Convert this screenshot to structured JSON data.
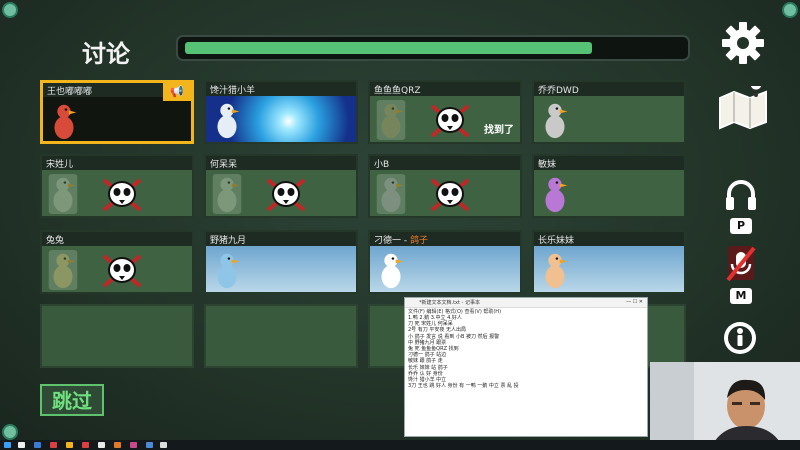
{
  "header": {
    "title": "讨论",
    "timer_fraction": 0.82
  },
  "players": [
    {
      "name": "王也嘟嘟嘟",
      "self": true,
      "dead": false,
      "bg": "dark",
      "avatar_color": "#d84a3a"
    },
    {
      "name": "馋汁猎小羊",
      "self": false,
      "dead": false,
      "bg": "burst",
      "avatar_color": "#e6eef5"
    },
    {
      "name": "鱼鱼鱼QRZ",
      "self": false,
      "dead": true,
      "found": "找到了",
      "avatar_color": "#b9b07a"
    },
    {
      "name": "乔乔DWD",
      "self": false,
      "dead": false,
      "bg": "plain",
      "avatar_color": "#c9c9c9"
    },
    {
      "name": "宋姓儿",
      "self": false,
      "dead": true,
      "avatar_color": "#c9d7c0"
    },
    {
      "name": "何呆呆",
      "self": false,
      "dead": true,
      "avatar_color": "#c9d7c0"
    },
    {
      "name": "小B",
      "self": false,
      "dead": true,
      "avatar_color": "#c9c9c9"
    },
    {
      "name": "敏妹",
      "self": false,
      "dead": false,
      "bg": "plain",
      "avatar_color": "#b978d6"
    },
    {
      "name": "兔兔",
      "self": false,
      "dead": true,
      "avatar_color": "#e9d58a"
    },
    {
      "name": "野猪九月",
      "self": false,
      "dead": false,
      "bg": "sky",
      "avatar_color": "#8fc6e8"
    },
    {
      "name": "刁德一 - ",
      "name_suffix": "鸽子",
      "self": false,
      "dead": false,
      "bg": "sky",
      "avatar_color": "#ffffff"
    },
    {
      "name": "长乐妹妹",
      "self": false,
      "dead": false,
      "bg": "sky",
      "avatar_color": "#f0c090"
    }
  ],
  "sidebar": {
    "settings_icon": "gear-icon",
    "map_icon": "map-icon",
    "headphones_key": "P",
    "mic_key": "M",
    "role_icon": "role-icon"
  },
  "skip_label": "跳过",
  "notepad": {
    "title": "*新建文本文档.txt - 记事本",
    "menu": "文件(F)  编辑(E)  格式(O)  查看(V)  帮助(H)",
    "lines": [
      "1.鸭 2.鹅 3.中立 4.好人",
      "刀 死 宋姓儿 何呆呆",
      "2号 有刀 平安夜 无人出局",
      "小 鸽子 发言 说 看到 小B 被刀 然后 报警",
      "中 野猪九月 跟票",
      "兔 死 鱼鱼鱼QRZ 找到",
      "刁德一 鸽子 站边",
      "敏妹 跟 鸽子 走",
      "长乐 妹妹 站 鸽子",
      "乔乔 认 好 身份",
      "馋汁 猎小羊 中立",
      "3刀 王也 跳 好人 身份 有 一鸭 一鹅 中立 票 乱 投"
    ]
  }
}
